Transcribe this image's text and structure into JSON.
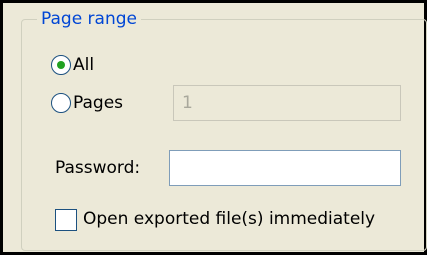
{
  "page_range": {
    "legend": "Page range",
    "all": {
      "label": "All",
      "selected": true
    },
    "pages": {
      "label": "Pages",
      "selected": false,
      "value": "1",
      "enabled": false
    }
  },
  "password": {
    "label": "Password:",
    "value": ""
  },
  "open_exported": {
    "label": "Open exported file(s) immediately",
    "checked": false
  },
  "colors": {
    "legend": "#0046d5",
    "background": "#ece9d8",
    "radio_dot": "#21a121",
    "border": "#7f9db9"
  }
}
